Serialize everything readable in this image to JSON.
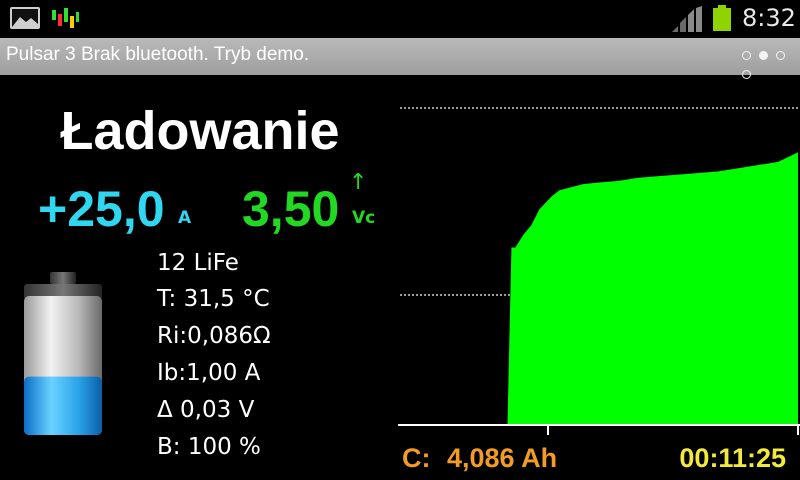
{
  "status_bar": {
    "time": "8:32",
    "icons": [
      "gallery-icon",
      "app-notification-icon",
      "signal-icon",
      "battery-icon"
    ],
    "battery_color": "#8fd400"
  },
  "title_bar": {
    "title": "Pulsar 3 Brak bluetooth. Tryb demo.",
    "page_dots": {
      "count": 4,
      "active": 1
    }
  },
  "main": {
    "mode": "Ładowanie",
    "current": {
      "value": "+25,0",
      "unit": "A",
      "color": "#2fd8f0"
    },
    "voltage": {
      "value": "3,50",
      "unit": "Vc",
      "trend": "↑",
      "color": "#22d922"
    },
    "battery_level": 0.42,
    "params": [
      "12 LiFe",
      "T: 31,5 °C",
      "Ri:0,086Ω",
      "Ib:1,00 A",
      "Δ  0,03 V",
      "B: 100 %"
    ]
  },
  "footer": {
    "capacity_label": "C:",
    "capacity_value": "4,086 Ah",
    "elapsed": "00:11:25"
  },
  "chart_data": {
    "type": "area",
    "color": "#00ff00",
    "grid": true,
    "x": [
      0,
      27,
      28,
      29,
      30,
      31,
      33,
      35,
      38,
      40,
      43,
      46,
      50,
      55,
      60,
      65,
      70,
      75,
      80,
      85,
      90,
      95,
      100
    ],
    "y": [
      0,
      0,
      0.56,
      0.56,
      0.58,
      0.6,
      0.63,
      0.68,
      0.72,
      0.74,
      0.75,
      0.76,
      0.765,
      0.77,
      0.78,
      0.785,
      0.79,
      0.795,
      0.8,
      0.81,
      0.82,
      0.83,
      0.86
    ],
    "xlim": [
      0,
      100
    ],
    "ylim": [
      0,
      1
    ]
  }
}
